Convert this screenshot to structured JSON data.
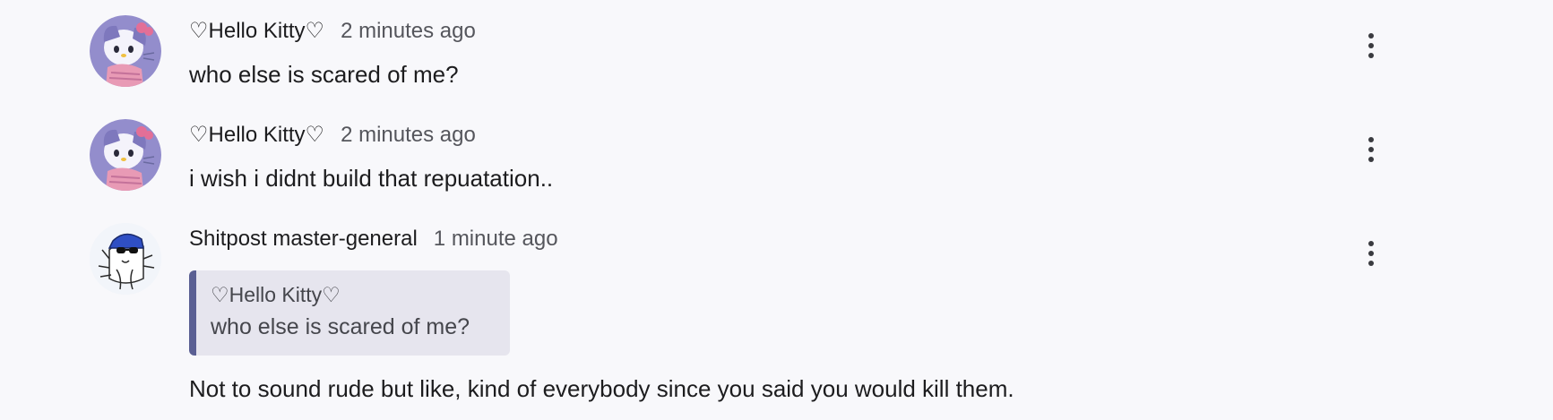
{
  "comments": [
    {
      "author": "♡Hello Kitty♡",
      "time": "2 minutes ago",
      "text": "who else is scared of me?",
      "avatar_icon": "hello-kitty-avatar-icon"
    },
    {
      "author": "♡Hello Kitty♡",
      "time": "2 minutes ago",
      "text": "i wish i didnt build that repuatation..",
      "avatar_icon": "hello-kitty-avatar-icon"
    },
    {
      "author": "Shitpost master-general",
      "time": "1 minute ago",
      "text": "Not to sound rude but like, kind of everybody since you said you would kill them.",
      "avatar_icon": "cat-sunglasses-avatar-icon",
      "quote": {
        "author": "♡Hello Kitty♡",
        "text": "who else is scared of me?"
      }
    }
  ],
  "menu_icon": "more-vertical-icon",
  "colors": {
    "background": "#f8f8fb",
    "quote_background": "#e6e5ee",
    "quote_accent": "#5a5f93",
    "avatar_purple": "#8b86c6",
    "avatar_pink": "#e89ab5"
  }
}
